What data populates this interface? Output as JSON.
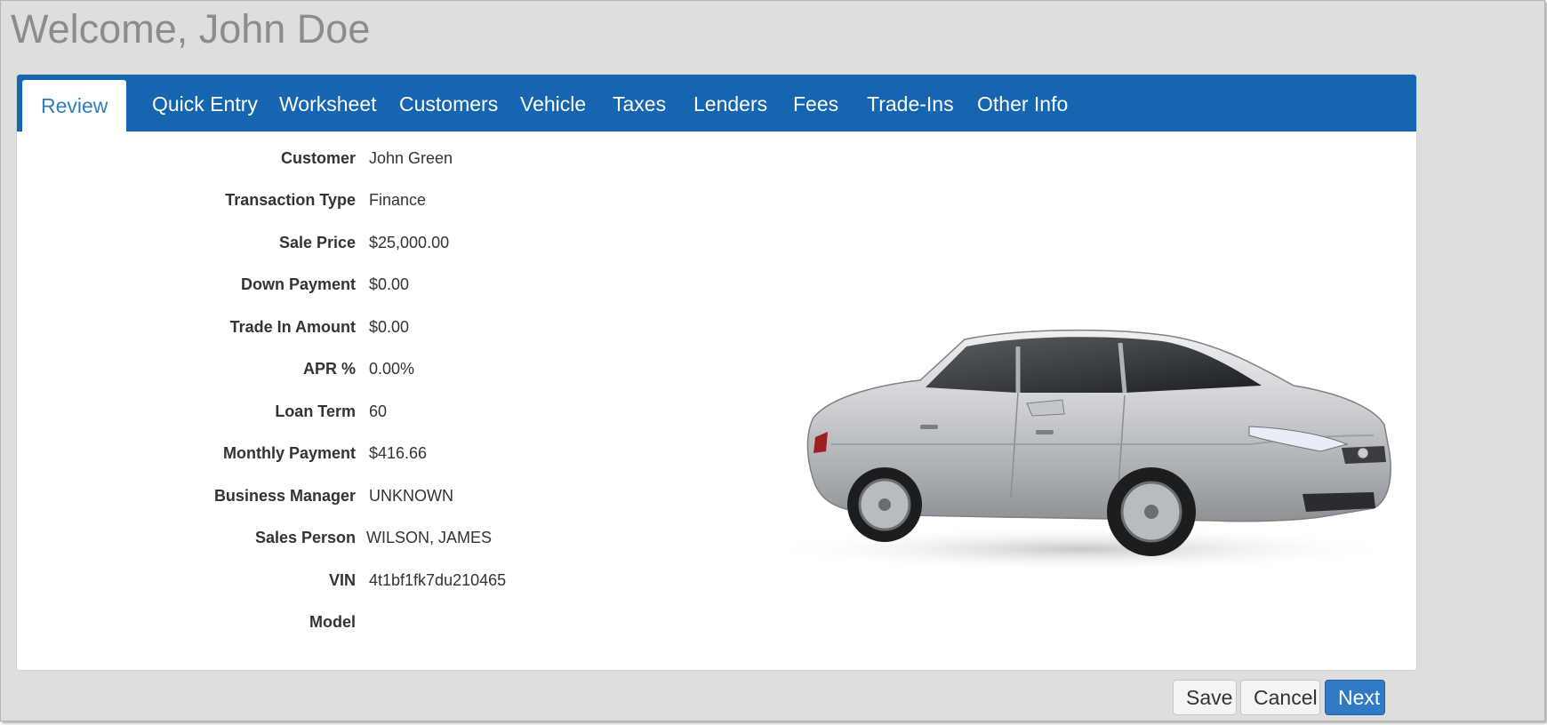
{
  "header": {
    "welcome": "Welcome, John Doe"
  },
  "tabs": [
    {
      "label": "Review",
      "active": true
    },
    {
      "label": "Quick Entry"
    },
    {
      "label": "Worksheet"
    },
    {
      "label": "Customers"
    },
    {
      "label": "Vehicle"
    },
    {
      "label": "Taxes"
    },
    {
      "label": "Lenders"
    },
    {
      "label": "Fees"
    },
    {
      "label": "Trade-Ins"
    },
    {
      "label": "Other Info"
    }
  ],
  "review": {
    "fields": [
      {
        "label": "Customer",
        "value": "John Green"
      },
      {
        "label": "Transaction Type",
        "value": "Finance"
      },
      {
        "label": "Sale Price",
        "value": "$25,000.00"
      },
      {
        "label": "Down Payment",
        "value": "$0.00"
      },
      {
        "label": "Trade In Amount",
        "value": "$0.00"
      },
      {
        "label": "APR %",
        "value": "0.00%"
      },
      {
        "label": "Loan Term",
        "value": "60"
      },
      {
        "label": "Monthly Payment",
        "value": "$416.66"
      },
      {
        "label": "Business Manager",
        "value": "UNKNOWN"
      },
      {
        "label": "Sales Person",
        "value": "WILSON, JAMES"
      },
      {
        "label": "VIN",
        "value": "4t1bf1fk7du210465"
      },
      {
        "label": "Model",
        "value": ""
      }
    ]
  },
  "vehicle_image": {
    "icon": "car-icon",
    "body_color": "#c9cbce"
  },
  "actions": {
    "save_label": "Save",
    "cancel_label": "Cancel",
    "next_label": "Next"
  },
  "colors": {
    "tab_bar": "#1565b0",
    "active_tab_text": "#2f7fbf",
    "primary_button": "#2f7ac2",
    "background": "#dedede"
  }
}
